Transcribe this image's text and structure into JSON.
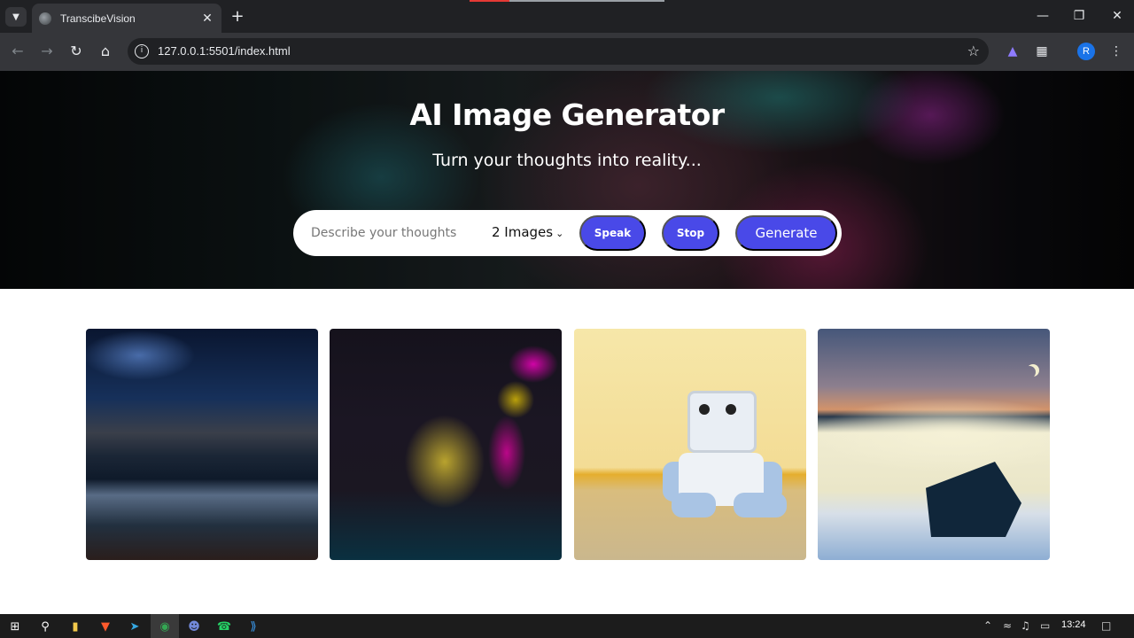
{
  "browser": {
    "tab_title": "TranscibeVision",
    "tab_favicon": "globe-icon",
    "url": "127.0.0.1:5501/index.html",
    "profile_initial": "R",
    "icons": {
      "tab_search": "chevron-down-icon",
      "close": "close-icon",
      "new_tab": "plus-icon",
      "back": "arrow-left-icon",
      "forward": "arrow-right-icon",
      "reload": "reload-icon",
      "home": "home-icon",
      "site_info": "info-icon",
      "bookmark": "star-icon",
      "extensions": "puzzle-icon"
    },
    "window_controls": [
      "minimize-icon",
      "restore-icon",
      "close-icon"
    ]
  },
  "hero": {
    "title": "AI Image Generator",
    "subtitle": "Turn your thoughts into reality...",
    "prompt_placeholder": "Describe your thoughts",
    "image_count_selected": "2 Images",
    "speak_label": "Speak",
    "stop_label": "Stop",
    "generate_label": "Generate",
    "accent_color": "#4949e8"
  },
  "gallery": {
    "images": [
      {
        "subject": "night mountain lake landscape"
      },
      {
        "subject": "neon-lit portrait of a girl"
      },
      {
        "subject": "toy robot plush"
      },
      {
        "subject": "snowy cabin at dusk illustration"
      }
    ]
  },
  "taskbar": {
    "apps": [
      "windows-start-icon",
      "search-icon",
      "file-explorer-icon",
      "brave-icon",
      "telegram-icon",
      "chrome-icon",
      "discord-icon",
      "whatsapp-icon",
      "vscode-icon"
    ],
    "tray": [
      "chevron-up-icon",
      "wifi-icon",
      "volume-icon",
      "battery-icon"
    ],
    "clock": "13:24",
    "notifications_icon": "notification-icon"
  }
}
